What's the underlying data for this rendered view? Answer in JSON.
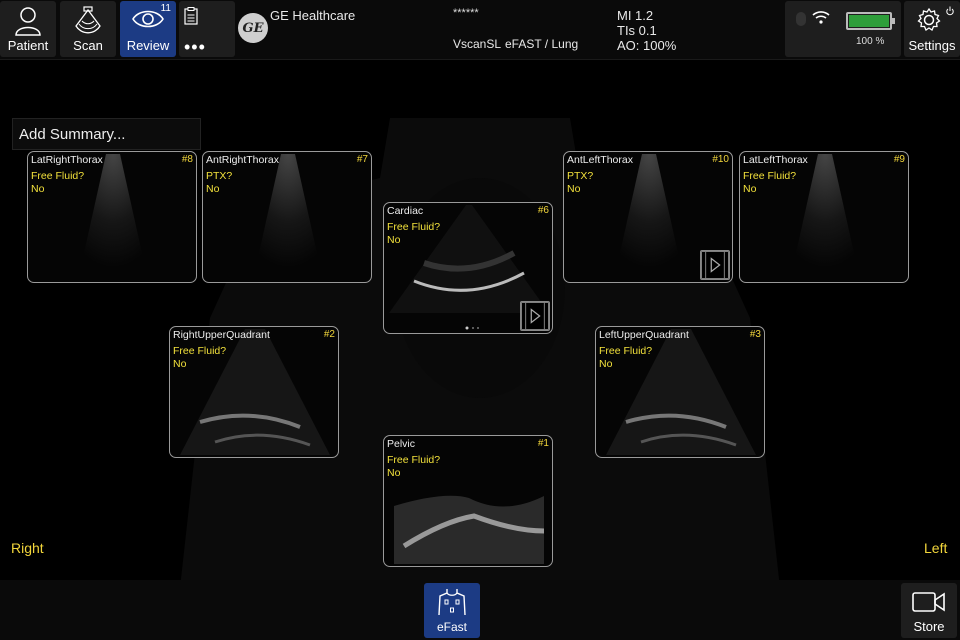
{
  "topbar": {
    "patient_label": "Patient",
    "scan_label": "Scan",
    "review_label": "Review",
    "review_count": "11",
    "more_label": "•••",
    "brand": "GE Healthcare",
    "patient_id": "******",
    "probe": "VscanSL",
    "preset": "eFAST / Lung",
    "mi": "MI 1.2",
    "tis": "TIs 0.1",
    "ao": "AO: 100%",
    "battery_pct": "100  %",
    "battery_level": 1.0,
    "settings_label": "Settings"
  },
  "summary_placeholder": "Add Summary...",
  "tiles": [
    {
      "name": "LatRightThorax",
      "num": "#8",
      "question": "Free Fluid?",
      "answer": "No"
    },
    {
      "name": "AntRightThorax",
      "num": "#7",
      "question": "PTX?",
      "answer": "No"
    },
    {
      "name": "Cardiac",
      "num": "#6",
      "question": "Free Fluid?",
      "answer": "No"
    },
    {
      "name": "AntLeftThorax",
      "num": "#10",
      "question": "PTX?",
      "answer": "No"
    },
    {
      "name": "LatLeftThorax",
      "num": "#9",
      "question": "Free Fluid?",
      "answer": "No"
    },
    {
      "name": "RightUpperQuadrant",
      "num": "#2",
      "question": "Free Fluid?",
      "answer": "No"
    },
    {
      "name": "LeftUpperQuadrant",
      "num": "#3",
      "question": "Free Fluid?",
      "answer": "No"
    },
    {
      "name": "Pelvic",
      "num": "#1",
      "question": "Free Fluid?",
      "answer": "No"
    }
  ],
  "side_right": "Right",
  "side_left": "Left",
  "bottombar": {
    "efast_label": "eFast",
    "store_label": "Store"
  },
  "colors": {
    "accent": "#1c3b84",
    "annotation_yellow": "#f2e13b",
    "battery_green": "#2e9e3a"
  }
}
